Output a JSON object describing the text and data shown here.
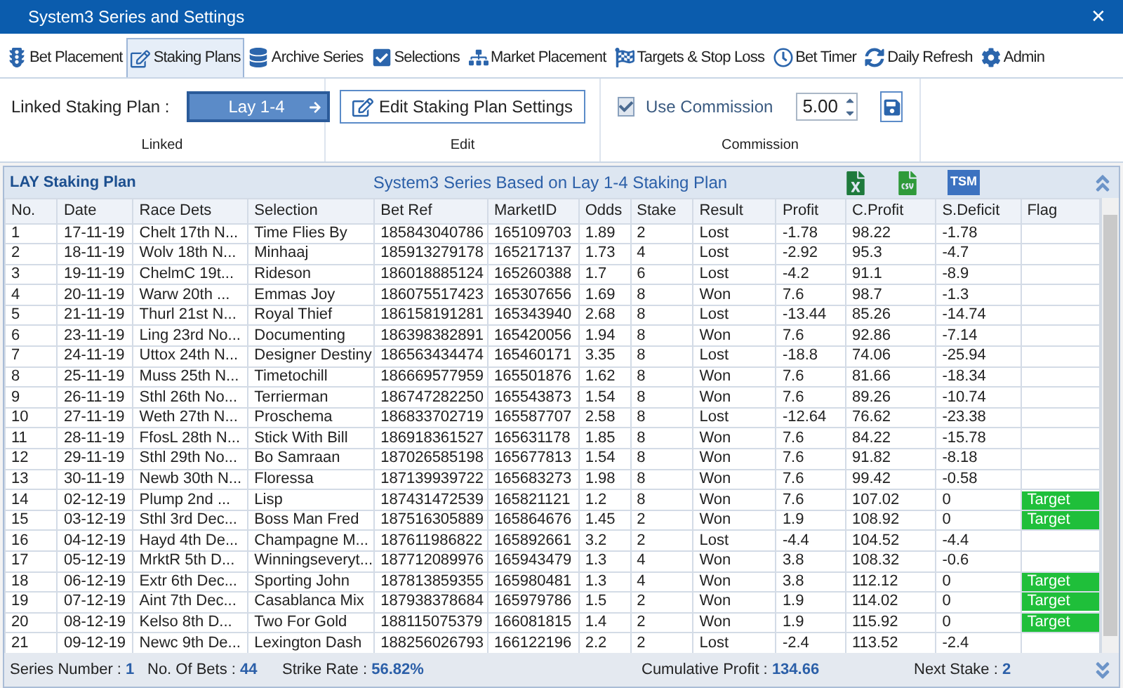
{
  "window": {
    "title": "System3 Series and Settings",
    "close": "✕"
  },
  "tabs": [
    {
      "label": "Bet Placement",
      "selected": false
    },
    {
      "label": "Staking Plans",
      "selected": true
    },
    {
      "label": "Archive Series",
      "selected": false
    },
    {
      "label": "Selections",
      "selected": false
    },
    {
      "label": "Market Placement",
      "selected": false
    },
    {
      "label": "Targets & Stop Loss",
      "selected": false
    },
    {
      "label": "Bet Timer",
      "selected": false
    },
    {
      "label": "Daily Refresh",
      "selected": false
    },
    {
      "label": "Admin",
      "selected": false
    }
  ],
  "ribbon": {
    "linked": {
      "label": "Linked Staking Plan :",
      "value": "Lay 1-4",
      "group": "Linked"
    },
    "edit": {
      "button": "Edit Staking Plan Settings",
      "group": "Edit"
    },
    "commission": {
      "label": "Use Commission",
      "checked": true,
      "value": "5.00",
      "group": "Commission"
    }
  },
  "panel": {
    "title": "LAY Staking Plan",
    "subtitle": "System3 Series Based on Lay 1-4 Staking Plan",
    "tsm_label": "TSM"
  },
  "table": {
    "columns": [
      "No.",
      "Date",
      "Race Dets",
      "Selection",
      "Bet Ref",
      "MarketID",
      "Odds",
      "Stake",
      "Result",
      "Profit",
      "C.Profit",
      "S.Deficit",
      "Flag"
    ],
    "rows": [
      {
        "cells": [
          "1",
          "17-11-19",
          "Chelt 17th N...",
          "Time Flies By",
          "185843040786",
          "165109703",
          "1.89",
          "2",
          "Lost",
          "-1.78",
          "98.22",
          "-1.78"
        ],
        "flag": ""
      },
      {
        "cells": [
          "2",
          "18-11-19",
          "Wolv 18th N...",
          "Minhaaj",
          "185913279178",
          "165217137",
          "1.73",
          "4",
          "Lost",
          "-2.92",
          "95.3",
          "-4.7"
        ],
        "flag": ""
      },
      {
        "cells": [
          "3",
          "19-11-19",
          "ChelmC 19t...",
          "Rideson",
          "186018885124",
          "165260388",
          "1.7",
          "6",
          "Lost",
          "-4.2",
          "91.1",
          "-8.9"
        ],
        "flag": ""
      },
      {
        "cells": [
          "4",
          "20-11-19",
          "Warw 20th ...",
          "Emmas Joy",
          "186075517423",
          "165307656",
          "1.69",
          "8",
          "Won",
          "7.6",
          "98.7",
          "-1.3"
        ],
        "flag": ""
      },
      {
        "cells": [
          "5",
          "21-11-19",
          "Thurl 21st N...",
          "Royal Thief",
          "186158191281",
          "165343940",
          "2.68",
          "8",
          "Lost",
          "-13.44",
          "85.26",
          "-14.74"
        ],
        "flag": ""
      },
      {
        "cells": [
          "6",
          "23-11-19",
          "Ling 23rd No...",
          "Documenting",
          "186398382891",
          "165420056",
          "1.94",
          "8",
          "Won",
          "7.6",
          "92.86",
          "-7.14"
        ],
        "flag": ""
      },
      {
        "cells": [
          "7",
          "24-11-19",
          "Uttox 24th N...",
          "Designer Destiny",
          "186563434474",
          "165460171",
          "3.35",
          "8",
          "Lost",
          "-18.8",
          "74.06",
          "-25.94"
        ],
        "flag": ""
      },
      {
        "cells": [
          "8",
          "25-11-19",
          "Muss 25th N...",
          "Timetochill",
          "186669577959",
          "165501876",
          "1.62",
          "8",
          "Won",
          "7.6",
          "81.66",
          "-18.34"
        ],
        "flag": ""
      },
      {
        "cells": [
          "9",
          "26-11-19",
          "Sthl 26th No...",
          "Terrierman",
          "186747282250",
          "165543873",
          "1.54",
          "8",
          "Won",
          "7.6",
          "89.26",
          "-10.74"
        ],
        "flag": ""
      },
      {
        "cells": [
          "10",
          "27-11-19",
          "Weth 27th N...",
          "Proschema",
          "186833702719",
          "165587707",
          "2.58",
          "8",
          "Lost",
          "-12.64",
          "76.62",
          "-23.38"
        ],
        "flag": ""
      },
      {
        "cells": [
          "11",
          "28-11-19",
          "FfosL 28th N...",
          "Stick With Bill",
          "186918361527",
          "165631178",
          "1.85",
          "8",
          "Won",
          "7.6",
          "84.22",
          "-15.78"
        ],
        "flag": ""
      },
      {
        "cells": [
          "12",
          "29-11-19",
          "Sthl 29th No...",
          "Bo Samraan",
          "187026585198",
          "165677813",
          "1.54",
          "8",
          "Won",
          "7.6",
          "91.82",
          "-8.18"
        ],
        "flag": ""
      },
      {
        "cells": [
          "13",
          "30-11-19",
          "Newb 30th N...",
          "Floressa",
          "187139939722",
          "165683273",
          "1.98",
          "8",
          "Won",
          "7.6",
          "99.42",
          "-0.58"
        ],
        "flag": ""
      },
      {
        "cells": [
          "14",
          "02-12-19",
          "Plump 2nd ...",
          "Lisp",
          "187431472539",
          "165821121",
          "1.2",
          "8",
          "Won",
          "7.6",
          "107.02",
          "0"
        ],
        "flag": "Target"
      },
      {
        "cells": [
          "15",
          "03-12-19",
          "Sthl 3rd Dec...",
          "Boss Man Fred",
          "187516305889",
          "165864676",
          "1.45",
          "2",
          "Won",
          "1.9",
          "108.92",
          "0"
        ],
        "flag": "Target"
      },
      {
        "cells": [
          "16",
          "04-12-19",
          "Hayd 4th De...",
          "Champagne M...",
          "187611986822",
          "165892661",
          "3.2",
          "2",
          "Lost",
          "-4.4",
          "104.52",
          "-4.4"
        ],
        "flag": ""
      },
      {
        "cells": [
          "17",
          "05-12-19",
          "MrktR 5th D...",
          "Winningseveryt...",
          "187712089976",
          "165943479",
          "1.3",
          "4",
          "Won",
          "3.8",
          "108.32",
          "-0.6"
        ],
        "flag": ""
      },
      {
        "cells": [
          "18",
          "06-12-19",
          "Extr 6th Dec...",
          "Sporting John",
          "187813859355",
          "165980481",
          "1.3",
          "4",
          "Won",
          "3.8",
          "112.12",
          "0"
        ],
        "flag": "Target"
      },
      {
        "cells": [
          "19",
          "07-12-19",
          "Aint 7th Dec...",
          "Casablanca Mix",
          "187938378684",
          "165979786",
          "1.5",
          "2",
          "Won",
          "1.9",
          "114.02",
          "0"
        ],
        "flag": "Target"
      },
      {
        "cells": [
          "20",
          "08-12-19",
          "Kelso 8th D...",
          "Two For Gold",
          "188115075379",
          "166081815",
          "1.4",
          "2",
          "Won",
          "1.9",
          "115.92",
          "0"
        ],
        "flag": "Target"
      },
      {
        "cells": [
          "21",
          "09-12-19",
          "Newc 9th De...",
          "Lexington Dash",
          "188256026793",
          "166122196",
          "2.2",
          "2",
          "Lost",
          "-2.4",
          "113.52",
          "-2.4"
        ],
        "flag": ""
      }
    ]
  },
  "status_bar": [
    {
      "label": "Series Number :",
      "value": "1"
    },
    {
      "label": "No. Of Bets :",
      "value": "44"
    },
    {
      "label": "Strike Rate :",
      "value": "56.82%"
    },
    {
      "label": "Cumulative Profit :",
      "value": "134.66"
    },
    {
      "label": "Next Stake :",
      "value": "2"
    }
  ]
}
